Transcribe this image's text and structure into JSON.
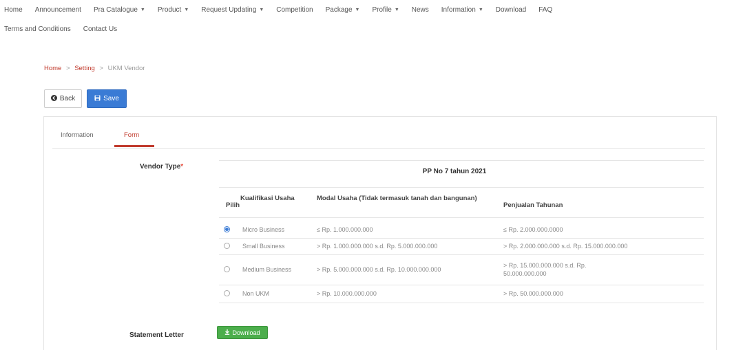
{
  "nav": {
    "row1": [
      {
        "label": "Home",
        "dropdown": false,
        "name": "nav-home"
      },
      {
        "label": "Announcement",
        "dropdown": false,
        "name": "nav-announcement"
      },
      {
        "label": "Pra Catalogue",
        "dropdown": true,
        "name": "nav-pra-catalogue"
      },
      {
        "label": "Product",
        "dropdown": true,
        "name": "nav-product"
      },
      {
        "label": "Request Updating",
        "dropdown": true,
        "name": "nav-request-updating"
      },
      {
        "label": "Competition",
        "dropdown": false,
        "name": "nav-competition"
      },
      {
        "label": "Package",
        "dropdown": true,
        "name": "nav-package"
      },
      {
        "label": "Profile",
        "dropdown": true,
        "name": "nav-profile"
      },
      {
        "label": "News",
        "dropdown": false,
        "name": "nav-news"
      },
      {
        "label": "Information",
        "dropdown": true,
        "name": "nav-information"
      },
      {
        "label": "Download",
        "dropdown": false,
        "name": "nav-download"
      },
      {
        "label": "FAQ",
        "dropdown": false,
        "name": "nav-faq"
      }
    ],
    "row2": [
      {
        "label": "Terms and Conditions",
        "dropdown": false,
        "name": "nav-terms"
      },
      {
        "label": "Contact Us",
        "dropdown": false,
        "name": "nav-contact-us"
      }
    ]
  },
  "breadcrumb": {
    "home": "Home",
    "setting": "Setting",
    "current": "UKM Vendor",
    "separator": ">"
  },
  "toolbar": {
    "back_label": "Back",
    "save_label": "Save"
  },
  "tabs": {
    "information": "Information",
    "form": "Form"
  },
  "form": {
    "vendor_type_label": "Vendor Type",
    "required_mark": "*",
    "statement_letter_label": "Statement Letter",
    "download_label": "Download"
  },
  "table": {
    "title": "PP No 7 tahun 2021",
    "headers": {
      "pilih": "Pilih",
      "kualifikasi": "Kualifikasi Usaha",
      "modal": "Modal Usaha (Tidak termasuk tanah dan bangunan)",
      "penjualan": "Penjualan Tahunan"
    },
    "rows": [
      {
        "selected": true,
        "kualifikasi": "Micro Business",
        "modal": "≤ Rp. 1.000.000.000",
        "penjualan": "≤ Rp. 2.000.000.0000"
      },
      {
        "selected": false,
        "kualifikasi": "Small Business",
        "modal": "> Rp. 1.000.000.000 s.d. Rp. 5.000.000.000",
        "penjualan": "> Rp. 2.000.000.000 s.d. Rp. 15.000.000.000"
      },
      {
        "selected": false,
        "kualifikasi": "Medium Business",
        "modal": "> Rp. 5.000.000.000 s.d. Rp. 10.000.000.000",
        "penjualan": "> Rp. 15.000.000.000 s.d. Rp. 50.000.000.000"
      },
      {
        "selected": false,
        "kualifikasi": "Non UKM",
        "modal": "> Rp. 10.000.000.000",
        "penjualan": "> Rp. 50.000.000.000"
      }
    ]
  },
  "colors": {
    "accent_red": "#c0392b",
    "primary_blue": "#3a7bd5",
    "success_green": "#4cae4c"
  },
  "icons": {
    "back": "circle-arrow-left-icon",
    "save": "floppy-disk-icon",
    "download": "download-icon",
    "caret": "caret-down-icon"
  }
}
